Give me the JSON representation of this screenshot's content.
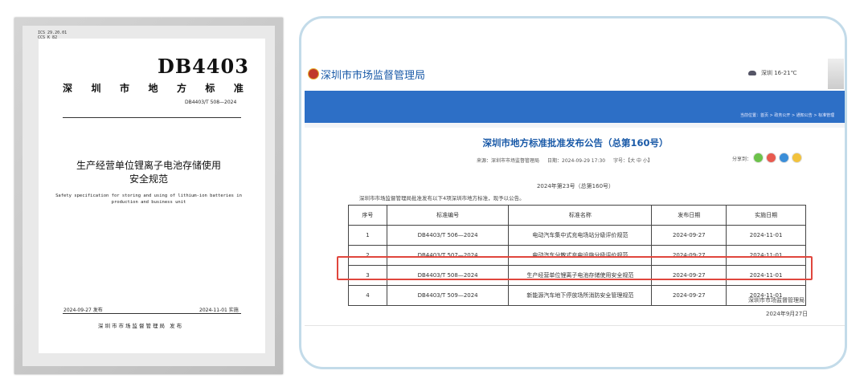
{
  "standard": {
    "ics_line1": "ICS 29.20.01",
    "ics_line2": "CCS K 82",
    "code": "DB4403",
    "type_chars": [
      "深",
      "圳",
      "市",
      "地",
      "方",
      "标",
      "准"
    ],
    "number": "DB4403/T 508—2024",
    "title_line1": "生产经营单位锂离子电池存储使用",
    "title_line2": "安全规范",
    "en_line1": "Safety specification for storing and using of lithium-ion batteries in",
    "en_line2": "production and business unit",
    "publish_date": "2024-09-27 发布",
    "implement_date": "2024-11-01 实施",
    "issuer": "深圳市市场监督管理局  发布"
  },
  "site": {
    "name": "深圳市市场监督管理局",
    "weather": "深圳 16-21℃",
    "breadcrumb": "当前位置：首页 > 政务公开 > 通知公告 > 标准管理",
    "notice_title": "深圳市地方标准批准发布公告（总第160号）",
    "meta_source": "来源：深圳市市场监督管理局",
    "meta_date": "日期：2024-09-29 17:30",
    "meta_font": "字号：【大 中 小】",
    "share_label": "分享到：",
    "sub_number": "2024年第23号（总第160号）",
    "intro": "深圳市市场监督管理局批准发布以下4项深圳市地方标准，现予以公告。",
    "sign_org": "深圳市市场监督管理局",
    "sign_date": "2024年9月27日"
  },
  "table": {
    "headers": [
      "序号",
      "标准编号",
      "标准名称",
      "发布日期",
      "实施日期"
    ],
    "rows": [
      [
        "1",
        "DB4403/T 506—2024",
        "电动汽车集中式充电场站分级评价规范",
        "2024-09-27",
        "2024-11-01"
      ],
      [
        "2",
        "DB4403/T 507—2024",
        "电动汽车分散式充电设施分级评价规范",
        "2024-09-27",
        "2024-11-01"
      ],
      [
        "3",
        "DB4403/T 508—2024",
        "生产经营单位锂离子电池存储使用安全规范",
        "2024-09-27",
        "2024-11-01"
      ],
      [
        "4",
        "DB4403/T 509—2024",
        "新能源汽车地下停放场所消防安全管理规范",
        "2024-09-27",
        "2024-11-01"
      ]
    ]
  },
  "colors": {
    "accent": "#2d6fc6",
    "highlight": "#e0463d"
  }
}
